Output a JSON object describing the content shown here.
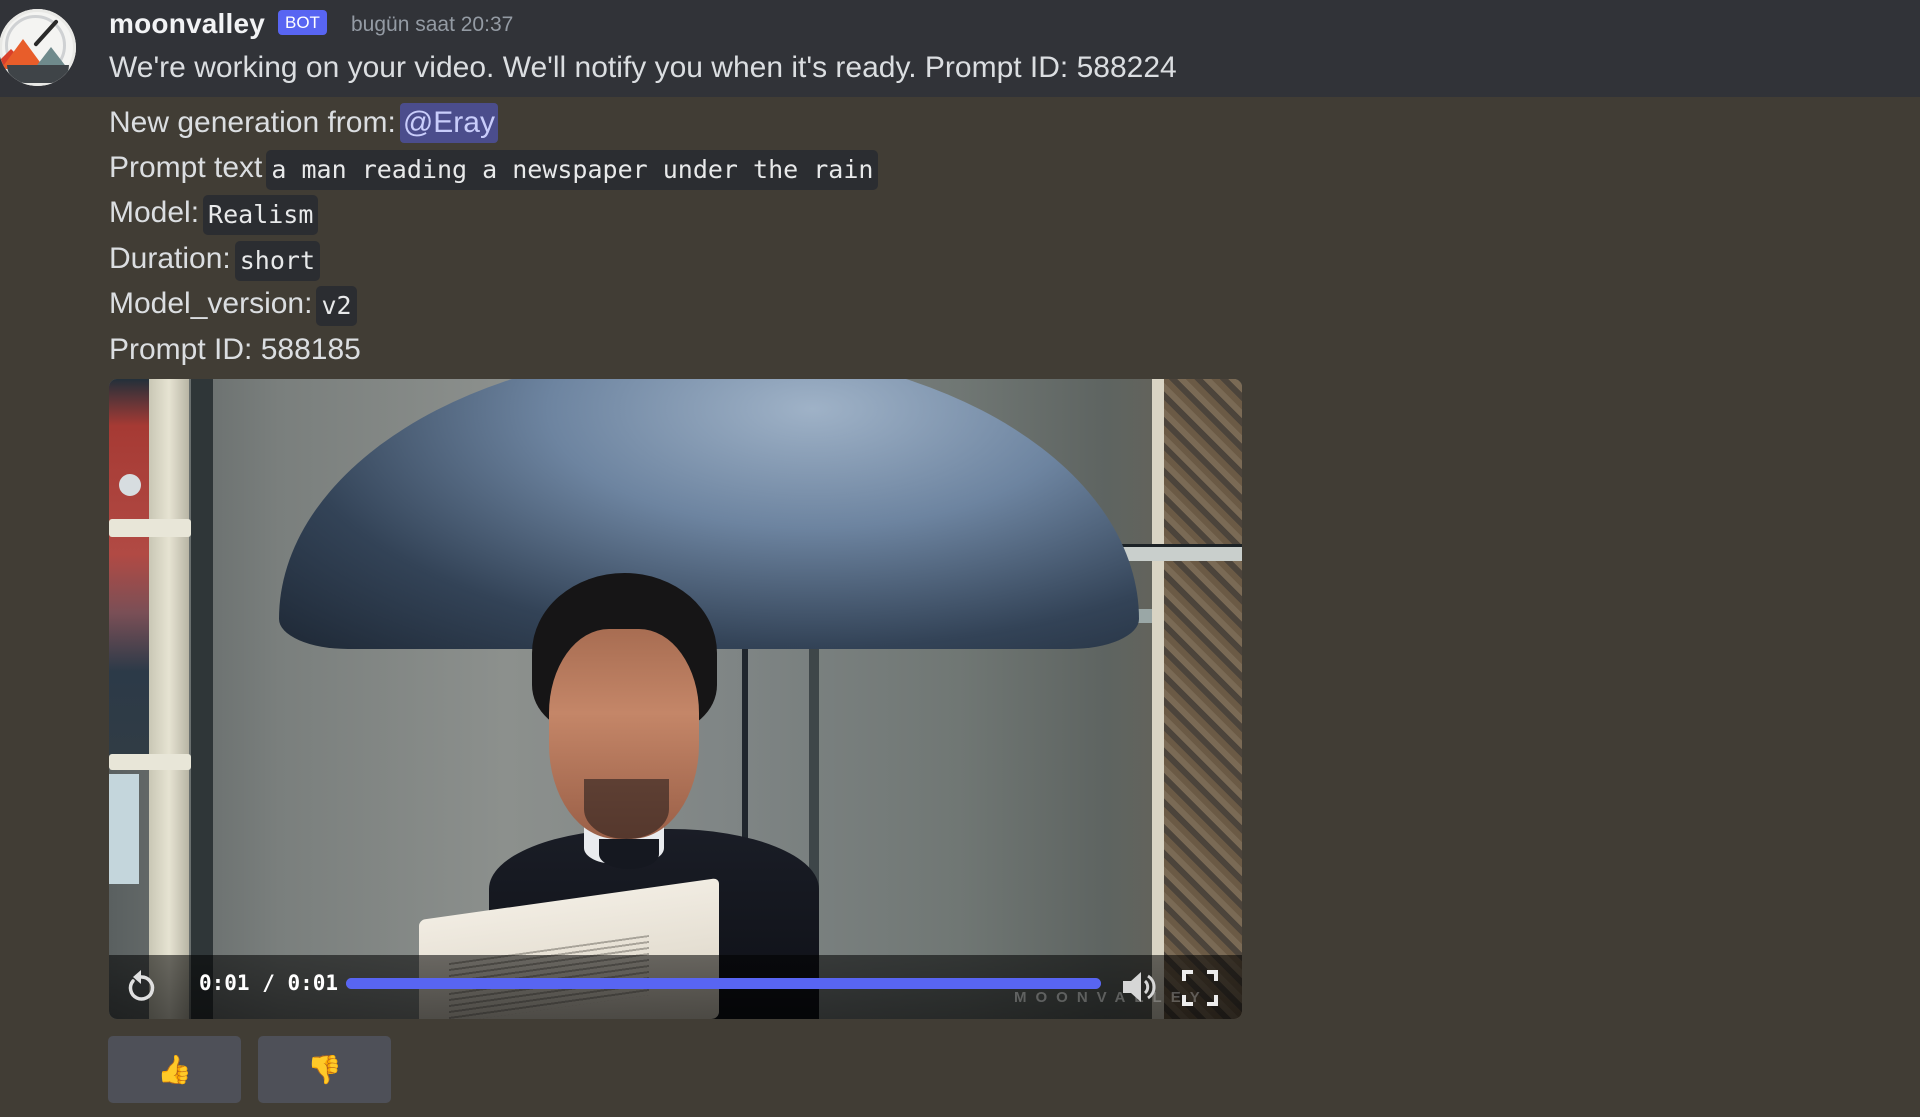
{
  "message": {
    "author": "moonvalley",
    "badge": "BOT",
    "timestamp": "bugün saat 20:37",
    "status_text": "We're working on your video. We'll notify you when it's ready. Prompt ID: 588224"
  },
  "generation": {
    "from_label": "New generation from:",
    "mention": "@Eray",
    "prompt_label": "Prompt text",
    "prompt_value": "a man reading a newspaper under the rain",
    "model_label": "Model:",
    "model_value": "Realism",
    "duration_label": "Duration:",
    "duration_value": "short",
    "model_version_label": "Model_version:",
    "model_version_value": "v2",
    "prompt_id_text": "Prompt ID: 588185"
  },
  "video": {
    "time_display": "0:01 / 0:01",
    "progress_percent": 100,
    "watermark": "MOONVALLEY",
    "accent_color": "#5865f2",
    "icons": [
      "replay-icon",
      "volume-icon",
      "fullscreen-icon"
    ]
  },
  "reactions": [
    {
      "emoji": "👍",
      "icon": "thumbs-up-icon"
    },
    {
      "emoji": "👎",
      "icon": "thumbs-down-icon"
    }
  ]
}
